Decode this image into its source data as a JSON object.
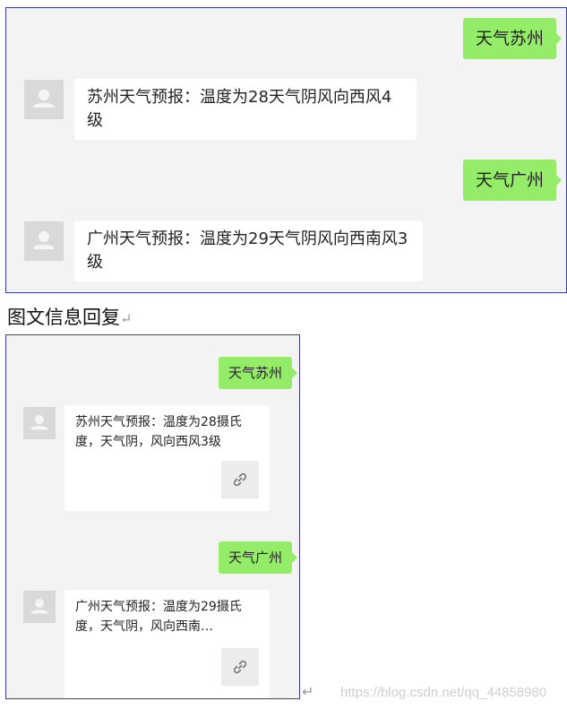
{
  "chat_text": {
    "messages": [
      {
        "from": "user",
        "text": "天气苏州"
      },
      {
        "from": "bot",
        "text": "苏州天气预报：温度为28天气阴风向西风4级"
      },
      {
        "from": "user",
        "text": "天气广州"
      },
      {
        "from": "bot",
        "text": "广州天气预报：温度为29天气阴风向西南风3级"
      }
    ]
  },
  "caption": "图文信息回复",
  "chat_news": {
    "messages": [
      {
        "from": "user",
        "text": "天气苏州"
      },
      {
        "from": "bot",
        "text": "苏州天气预报：温度为28摄氏度，天气阴，风向西风3级",
        "icon": "link-icon"
      },
      {
        "from": "user",
        "text": "天气广州"
      },
      {
        "from": "bot",
        "text": "广州天气预报：温度为29摄氏度，天气阴，风向西南…",
        "icon": "link-icon"
      }
    ]
  },
  "return_mark": "↵",
  "watermark": "https://blog.csdn.net/qq_44858980",
  "colors": {
    "user_bubble": "#95ec69",
    "bot_bubble": "#ffffff",
    "panel_bg": "#f3f3f3",
    "panel_border": "#3a3aa8"
  }
}
